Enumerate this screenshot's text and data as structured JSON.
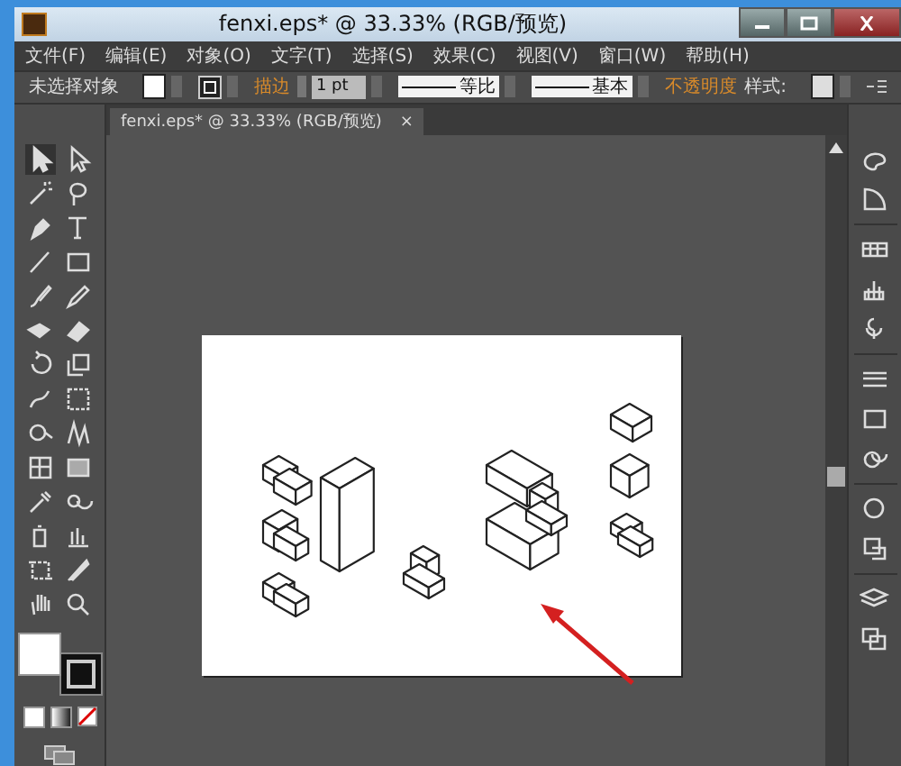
{
  "window": {
    "title": "fenxi.eps* @ 33.33% (RGB/预览)"
  },
  "menu": [
    "文件(F)",
    "编辑(E)",
    "对象(O)",
    "文字(T)",
    "选择(S)",
    "效果(C)",
    "视图(V)",
    "窗口(W)",
    "帮助(H)"
  ],
  "control_bar": {
    "selection": "未选择对象",
    "stroke_label": "描边",
    "stroke_weight": "1 pt",
    "profile": "等比",
    "brush": "基本",
    "opacity_label": "不透明度",
    "style_label": "样式:"
  },
  "document_tab": {
    "title": "fenxi.eps* @ 33.33% (RGB/预览)",
    "close": "×"
  }
}
